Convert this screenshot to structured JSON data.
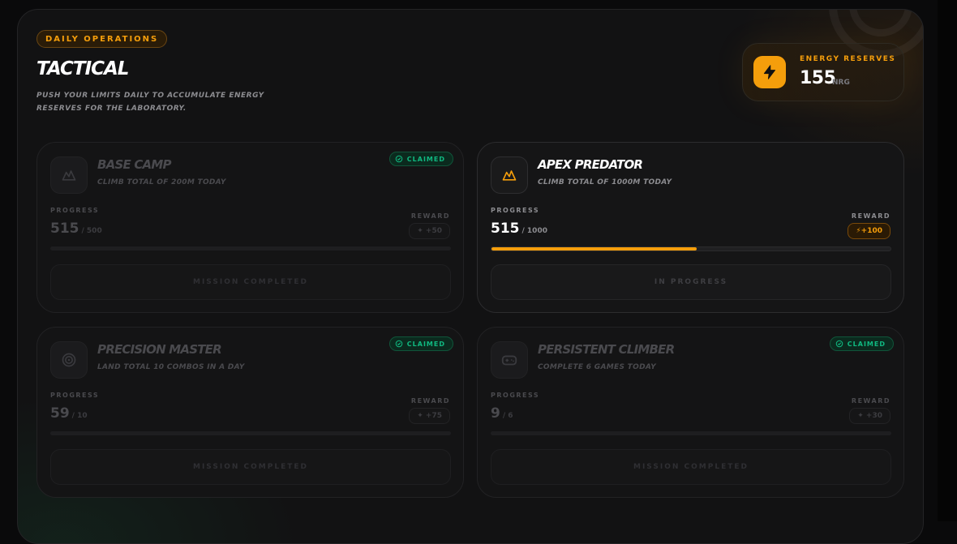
{
  "header": {
    "tag": "DAILY OPERATIONS",
    "title": "TACTICAL",
    "subtitle": "PUSH YOUR LIMITS DAILY TO ACCUMULATE ENERGY RESERVES FOR THE LABORATORY."
  },
  "energy": {
    "label": "ENERGY RESERVES",
    "value": "155",
    "unit": "NRG",
    "icon": "lightning-icon",
    "accent": "#f59e0b"
  },
  "labels": {
    "progress": "PROGRESS",
    "reward": "REWARD",
    "claimed": "CLAIMED"
  },
  "missions": [
    {
      "name": "BASE CAMP",
      "desc": "CLIMB TOTAL OF 200M TODAY",
      "icon": "mountain-icon",
      "current": "515",
      "total": "/ 500",
      "progress_fraction": 1.0,
      "reward": "+50",
      "status": "MISSION COMPLETED",
      "claimed": true
    },
    {
      "name": "APEX PREDATOR",
      "desc": "CLIMB TOTAL OF 1000M TODAY",
      "icon": "mountain-icon",
      "current": "515",
      "total": "/ 1000",
      "progress_fraction": 0.515,
      "reward": "+100",
      "status": "IN PROGRESS",
      "claimed": false
    },
    {
      "name": "PRECISION MASTER",
      "desc": "LAND TOTAL 10 COMBOS IN A DAY",
      "icon": "target-icon",
      "current": "59",
      "total": "/ 10",
      "progress_fraction": 1.0,
      "reward": "+75",
      "status": "MISSION COMPLETED",
      "claimed": true
    },
    {
      "name": "PERSISTENT CLIMBER",
      "desc": "COMPLETE 6 GAMES TODAY",
      "icon": "gamepad-icon",
      "current": "9",
      "total": "/ 6",
      "progress_fraction": 1.0,
      "reward": "+30",
      "status": "MISSION COMPLETED",
      "claimed": true
    }
  ],
  "colors": {
    "accent": "#f59e0b",
    "claimed": "#10b981",
    "background": "#121213"
  }
}
